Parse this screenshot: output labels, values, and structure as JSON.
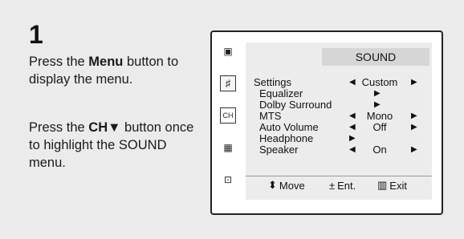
{
  "step": {
    "number": "1"
  },
  "instructions": {
    "p1_before": "Press the ",
    "p1_bold": "Menu",
    "p1_after": " button to display the menu.",
    "p2_before": "Press the ",
    "p2_bold": "CH▼",
    "p2_after": " button once to highlight the SOUND menu."
  },
  "sidebar": {
    "icons": [
      {
        "name": "picture-icon",
        "glyph": "▣"
      },
      {
        "name": "sound-icon",
        "glyph": "♯"
      },
      {
        "name": "channel-icon",
        "glyph": "CH"
      },
      {
        "name": "function-icon",
        "glyph": "▦"
      },
      {
        "name": "setup-icon",
        "glyph": "⊡"
      }
    ]
  },
  "menu": {
    "title": "SOUND",
    "rows": [
      {
        "label": "Settings",
        "value": "Custom",
        "left_arrow": "◀",
        "right_arrow": "▶",
        "mid_arrow": ""
      },
      {
        "label": "Equalizer",
        "value": "",
        "left_arrow": "",
        "right_arrow": "",
        "mid_arrow": "▶"
      },
      {
        "label": "Dolby Surround",
        "value": "",
        "left_arrow": "",
        "right_arrow": "",
        "mid_arrow": "▶"
      },
      {
        "label": "MTS",
        "value": "Mono",
        "left_arrow": "◀",
        "right_arrow": "▶",
        "mid_arrow": ""
      },
      {
        "label": "Auto Volume",
        "value": "Off",
        "left_arrow": "◀",
        "right_arrow": "▶",
        "mid_arrow": ""
      },
      {
        "label": "Headphone",
        "value": "",
        "left_arrow": "▶",
        "right_arrow": "",
        "mid_arrow": ""
      },
      {
        "label": "Speaker",
        "value": "On",
        "left_arrow": "◀",
        "right_arrow": "▶",
        "mid_arrow": ""
      }
    ],
    "footer": {
      "move_icon": "⬍",
      "move_label": "Move",
      "enter_icon": "±",
      "enter_label": "Ent.",
      "exit_icon": "▥",
      "exit_label": "Exit"
    }
  }
}
